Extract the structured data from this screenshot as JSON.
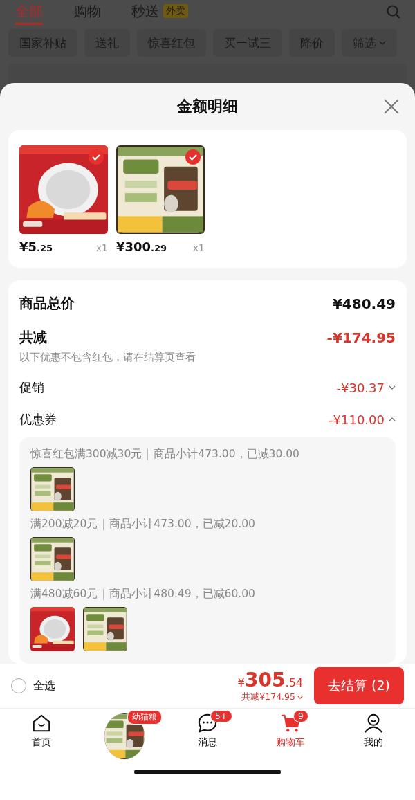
{
  "top_tabs": [
    {
      "label": "全部",
      "selected": true
    },
    {
      "label": "购物",
      "selected": false
    },
    {
      "label": "秒送",
      "selected": false,
      "badge": "外卖"
    }
  ],
  "filters": [
    {
      "label": "国家补贴"
    },
    {
      "label": "送礼"
    },
    {
      "label": "惊喜红包"
    },
    {
      "label": "买一试三"
    },
    {
      "label": "降价"
    },
    {
      "label": "筛选",
      "dropdown": true
    }
  ],
  "sheet": {
    "title": "金额明细",
    "products": [
      {
        "kind": "lamp",
        "checked": true,
        "price_main": "¥5",
        "price_cents": ".25",
        "qty": "x1"
      },
      {
        "kind": "catfood",
        "checked": true,
        "price_main": "¥300",
        "price_cents": ".29",
        "qty": "x1"
      }
    ],
    "total": {
      "label": "商品总价",
      "value": "¥480.49"
    },
    "discount": {
      "label": "共减",
      "value": "-¥174.95",
      "note": "以下优惠不包含红包，请在结算页查看"
    },
    "lines": [
      {
        "label": "促销",
        "value": "-¥30.37",
        "expanded": false
      },
      {
        "label": "优惠券",
        "value": "-¥110.00",
        "expanded": true
      }
    ],
    "coupons": [
      {
        "rule": "惊喜红包满300减30元",
        "detail": "商品小计473.00，已减30.00",
        "items": [
          {
            "kind": "catfood"
          }
        ]
      },
      {
        "rule": "满200减20元",
        "detail": "商品小计473.00，已减20.00",
        "items": [
          {
            "kind": "catfood"
          }
        ]
      },
      {
        "rule": "满480减60元",
        "detail": "商品小计480.49，已减60.00",
        "items": [
          {
            "kind": "lamp"
          },
          {
            "kind": "catfood"
          }
        ]
      }
    ]
  },
  "checkout": {
    "select_all": {
      "label": "全选",
      "checked": false
    },
    "currency": "¥",
    "amount": "305",
    "cents": ".54",
    "saved": "共减¥174.95",
    "button": "去结算 (2)"
  },
  "nav": [
    {
      "kind": "home",
      "label": "首页",
      "selected": false
    },
    {
      "kind": "promo",
      "badge": "幼猫粮",
      "selected": false
    },
    {
      "kind": "message",
      "label": "消息",
      "badge": "5+",
      "selected": false
    },
    {
      "kind": "cart",
      "label": "购物车",
      "badge": "9",
      "selected": true
    },
    {
      "kind": "me",
      "label": "我的",
      "selected": false
    }
  ]
}
